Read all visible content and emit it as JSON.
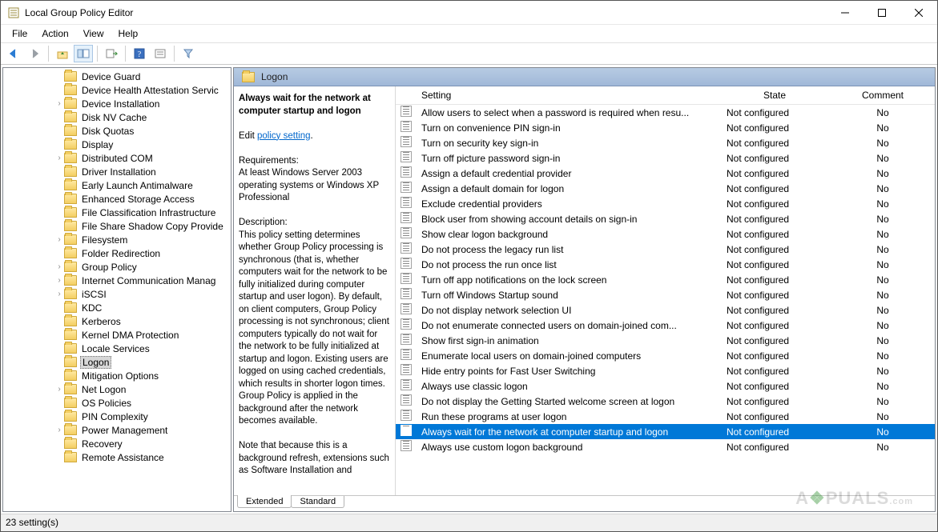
{
  "title": "Local Group Policy Editor",
  "menu": {
    "items": [
      "File",
      "Action",
      "View",
      "Help"
    ]
  },
  "tree": {
    "selected_index": 16,
    "nodes": [
      {
        "label": "Device Guard",
        "expandable": false
      },
      {
        "label": "Device Health Attestation Servic",
        "expandable": false
      },
      {
        "label": "Device Installation",
        "expandable": true
      },
      {
        "label": "Disk NV Cache",
        "expandable": false
      },
      {
        "label": "Disk Quotas",
        "expandable": false
      },
      {
        "label": "Display",
        "expandable": false
      },
      {
        "label": "Distributed COM",
        "expandable": true
      },
      {
        "label": "Driver Installation",
        "expandable": false
      },
      {
        "label": "Early Launch Antimalware",
        "expandable": false
      },
      {
        "label": "Enhanced Storage Access",
        "expandable": false
      },
      {
        "label": "File Classification Infrastructure",
        "expandable": false
      },
      {
        "label": "File Share Shadow Copy Provide",
        "expandable": false
      },
      {
        "label": "Filesystem",
        "expandable": true
      },
      {
        "label": "Folder Redirection",
        "expandable": false
      },
      {
        "label": "Group Policy",
        "expandable": true
      },
      {
        "label": "Internet Communication Manag",
        "expandable": true
      },
      {
        "label": "iSCSI",
        "expandable": true
      },
      {
        "label": "KDC",
        "expandable": false
      },
      {
        "label": "Kerberos",
        "expandable": false
      },
      {
        "label": "Kernel DMA Protection",
        "expandable": false
      },
      {
        "label": "Locale Services",
        "expandable": false
      },
      {
        "label": "Logon",
        "expandable": false,
        "selected": true
      },
      {
        "label": "Mitigation Options",
        "expandable": false
      },
      {
        "label": "Net Logon",
        "expandable": true
      },
      {
        "label": "OS Policies",
        "expandable": false
      },
      {
        "label": "PIN Complexity",
        "expandable": false
      },
      {
        "label": "Power Management",
        "expandable": true
      },
      {
        "label": "Recovery",
        "expandable": false
      },
      {
        "label": "Remote Assistance",
        "expandable": false
      }
    ]
  },
  "crumb": "Logon",
  "details": {
    "title": "Always wait for the network at computer startup and logon",
    "edit_prefix": "Edit ",
    "edit_link": "policy setting",
    "requirements_h": "Requirements:",
    "requirements": "At least Windows Server 2003 operating systems or Windows XP Professional",
    "description_h": "Description:",
    "description": "This policy setting determines whether Group Policy processing is synchronous (that is, whether computers wait for the network to be fully initialized during computer startup and user logon). By default, on client computers, Group Policy processing is not synchronous; client computers typically do not wait for the network to be fully initialized at startup and logon. Existing users are logged on using cached credentials, which results in shorter logon times. Group Policy is applied in the background after the network becomes available.",
    "note": "Note that because this is a background refresh, extensions such as Software Installation and"
  },
  "columns": {
    "setting": "Setting",
    "state": "State",
    "comment": "Comment"
  },
  "settings": {
    "selected_index": 21,
    "rows": [
      {
        "name": "Allow users to select when a password is required when resu...",
        "state": "Not configured",
        "comment": "No"
      },
      {
        "name": "Turn on convenience PIN sign-in",
        "state": "Not configured",
        "comment": "No"
      },
      {
        "name": "Turn on security key sign-in",
        "state": "Not configured",
        "comment": "No"
      },
      {
        "name": "Turn off picture password sign-in",
        "state": "Not configured",
        "comment": "No"
      },
      {
        "name": "Assign a default credential provider",
        "state": "Not configured",
        "comment": "No"
      },
      {
        "name": "Assign a default domain for logon",
        "state": "Not configured",
        "comment": "No"
      },
      {
        "name": "Exclude credential providers",
        "state": "Not configured",
        "comment": "No"
      },
      {
        "name": "Block user from showing account details on sign-in",
        "state": "Not configured",
        "comment": "No"
      },
      {
        "name": "Show clear logon background",
        "state": "Not configured",
        "comment": "No"
      },
      {
        "name": "Do not process the legacy run list",
        "state": "Not configured",
        "comment": "No"
      },
      {
        "name": "Do not process the run once list",
        "state": "Not configured",
        "comment": "No"
      },
      {
        "name": "Turn off app notifications on the lock screen",
        "state": "Not configured",
        "comment": "No"
      },
      {
        "name": "Turn off Windows Startup sound",
        "state": "Not configured",
        "comment": "No"
      },
      {
        "name": "Do not display network selection UI",
        "state": "Not configured",
        "comment": "No"
      },
      {
        "name": "Do not enumerate connected users on domain-joined com...",
        "state": "Not configured",
        "comment": "No"
      },
      {
        "name": "Show first sign-in animation",
        "state": "Not configured",
        "comment": "No"
      },
      {
        "name": "Enumerate local users on domain-joined computers",
        "state": "Not configured",
        "comment": "No"
      },
      {
        "name": "Hide entry points for Fast User Switching",
        "state": "Not configured",
        "comment": "No"
      },
      {
        "name": "Always use classic logon",
        "state": "Not configured",
        "comment": "No"
      },
      {
        "name": "Do not display the Getting Started welcome screen at logon",
        "state": "Not configured",
        "comment": "No"
      },
      {
        "name": "Run these programs at user logon",
        "state": "Not configured",
        "comment": "No"
      },
      {
        "name": "Always wait for the network at computer startup and logon",
        "state": "Not configured",
        "comment": "No"
      },
      {
        "name": "Always use custom logon background",
        "state": "Not configured",
        "comment": "No"
      }
    ]
  },
  "tabs": {
    "extended": "Extended",
    "standard": "Standard"
  },
  "status": "23 setting(s)",
  "watermark": "A  PUALS"
}
